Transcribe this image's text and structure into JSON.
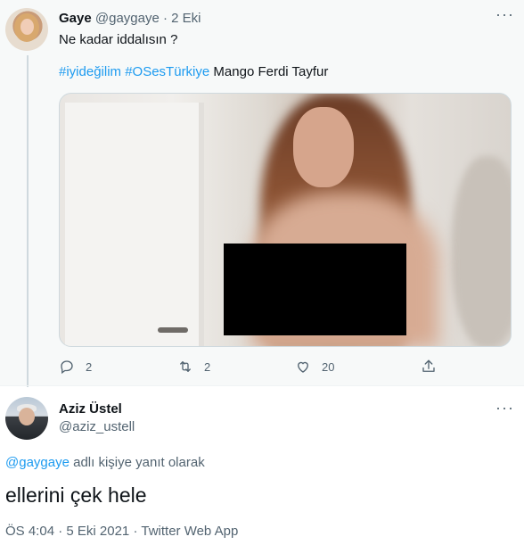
{
  "parent_tweet": {
    "author_name": "Gaye",
    "handle": "@gaygaye",
    "separator": "·",
    "date": "2 Eki",
    "text": "Ne kadar iddalısın ?",
    "hashtags": [
      "#iyideğilim",
      "#OSesTürkiye"
    ],
    "trailing_text": "Mango Ferdi Tayfur",
    "counts": {
      "replies": "2",
      "retweets": "2",
      "likes": "20"
    }
  },
  "reply_tweet": {
    "author_name": "Aziz Üstel",
    "handle": "@aziz_ustell",
    "replying_mention": "@gaygaye",
    "replying_suffix": "adlı kişiye yanıt olarak",
    "text": "ellerini çek hele",
    "time": "ÖS 4:04",
    "date": "5 Eki 2021",
    "source": "Twitter Web App",
    "separator": "·"
  },
  "icons": {
    "more": "more-icon",
    "reply": "reply-icon",
    "retweet": "retweet-icon",
    "like": "like-icon",
    "share": "share-icon"
  },
  "colors": {
    "accent": "#1d9bf0",
    "secondary_text": "#536471",
    "primary_text": "#0f1419"
  }
}
